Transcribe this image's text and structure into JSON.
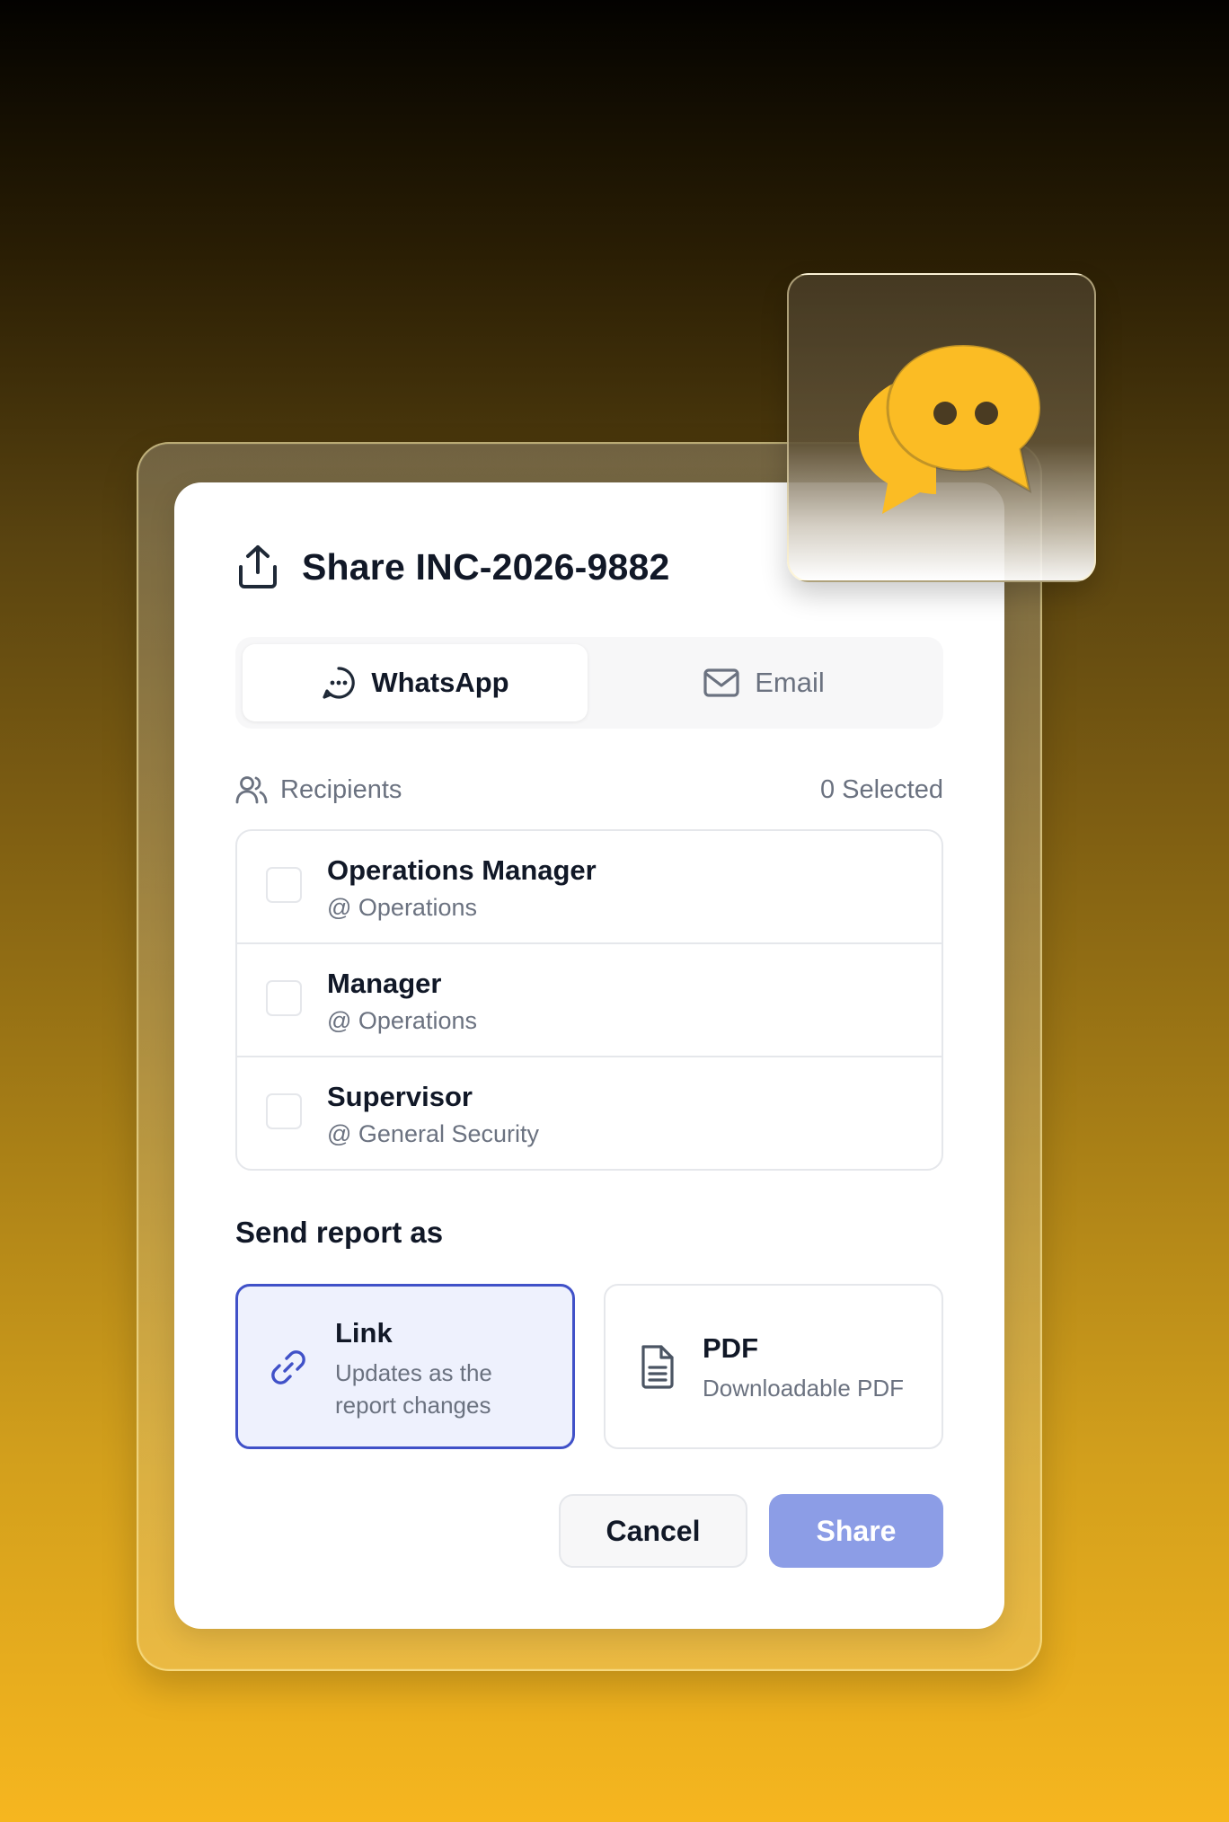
{
  "dialog": {
    "title": "Share INC-2026-9882",
    "title_icon": "share-upload-icon"
  },
  "tabs": [
    {
      "label": "WhatsApp",
      "icon": "chat-bubble-icon",
      "active": true
    },
    {
      "label": "Email",
      "icon": "mail-icon",
      "active": false
    }
  ],
  "recipients": {
    "label": "Recipients",
    "icon": "users-icon",
    "count_text": "0 Selected",
    "items": [
      {
        "name": "Operations Manager",
        "dept": "@ Operations",
        "checked": false
      },
      {
        "name": "Manager",
        "dept": "@ Operations",
        "checked": false
      },
      {
        "name": "Supervisor",
        "dept": "@ General Security",
        "checked": false
      }
    ]
  },
  "send_as": {
    "label": "Send report as",
    "options": [
      {
        "title": "Link",
        "desc_line1": "Updates as the",
        "desc_line2": "report changes",
        "icon": "link-icon",
        "selected": true
      },
      {
        "title": "PDF",
        "desc": "Downloadable PDF",
        "icon": "document-icon",
        "selected": false
      }
    ]
  },
  "actions": {
    "cancel_label": "Cancel",
    "share_label": "Share"
  },
  "colors": {
    "accent": "#4051c8",
    "share_button": "#8c9de6",
    "chat_badge_icon": "#fbbc24"
  },
  "badge_icon": "chat-bubbles-icon"
}
